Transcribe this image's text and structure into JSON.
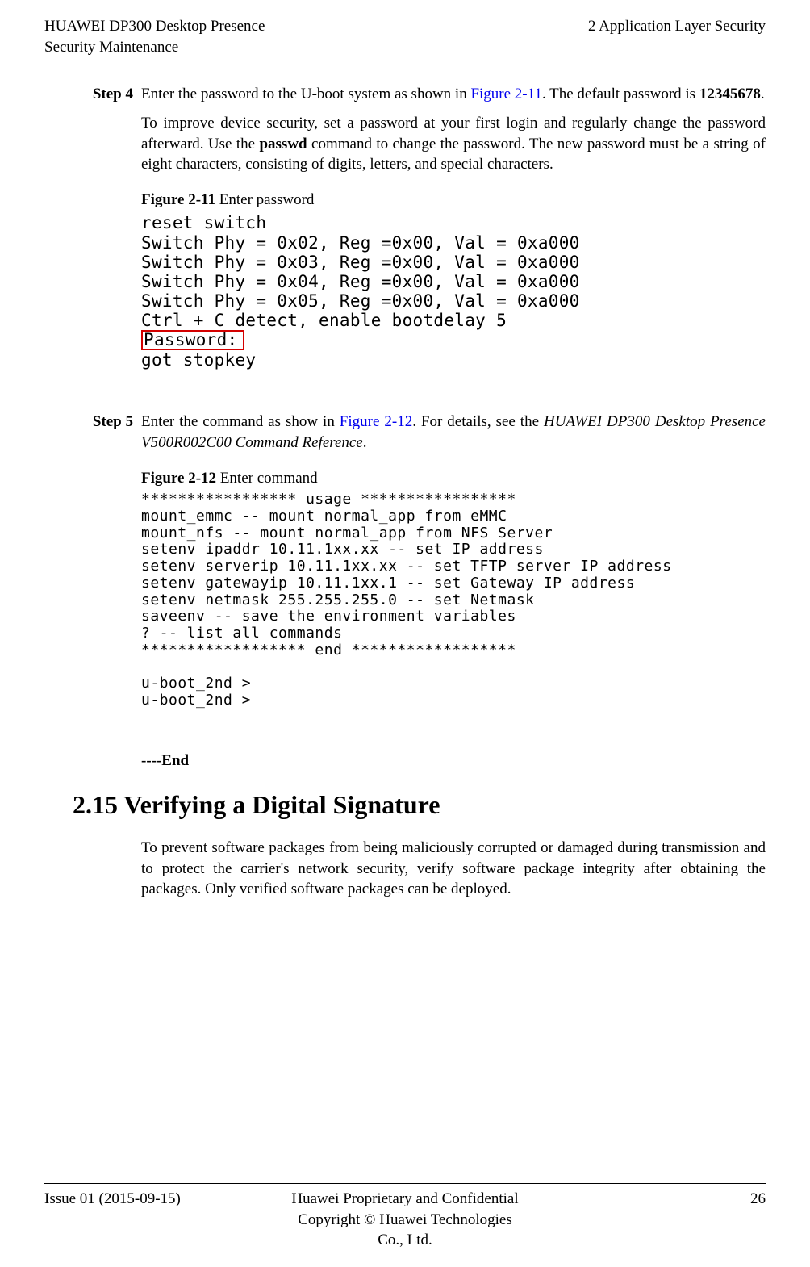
{
  "header": {
    "left_line1": "HUAWEI DP300 Desktop Presence",
    "left_line2": "Security Maintenance",
    "right_line1": "",
    "right_line2": "2 Application Layer Security"
  },
  "step4": {
    "label": "Step 4",
    "p1_a": "Enter the password to the U-boot system as shown in ",
    "p1_link": "Figure 2-11",
    "p1_b": ". The default password is ",
    "p1_bold": "12345678",
    "p1_c": ".",
    "p2_a": "To improve device security, set a password at your first login and regularly change the password afterward. Use the ",
    "p2_bold": "passwd",
    "p2_b": " command to change the password. The new password must be a string of eight characters, consisting of digits, letters, and special characters.",
    "fig_caption_bold": "Figure 2-11",
    "fig_caption_rest": " Enter password",
    "console_l1": "reset switch",
    "console_l2": "Switch Phy = 0x02, Reg =0x00, Val = 0xa000",
    "console_l3": "Switch Phy = 0x03, Reg =0x00, Val = 0xa000",
    "console_l4": "Switch Phy = 0x04, Reg =0x00, Val = 0xa000",
    "console_l5": "Switch Phy = 0x05, Reg =0x00, Val = 0xa000",
    "console_l6": "Ctrl + C detect, enable bootdelay 5",
    "console_pw": "Password:",
    "console_l8": "got stopkey"
  },
  "step5": {
    "label": "Step 5",
    "p1_a": "Enter the command as show in ",
    "p1_link": "Figure 2-12",
    "p1_b": ". For details, see the ",
    "p1_ital": "HUAWEI DP300 Desktop Presence V500R002C00 Command Reference",
    "p1_c": ".",
    "fig_caption_bold": "Figure 2-12",
    "fig_caption_rest": " Enter command",
    "console_l1": "***************** usage *****************",
    "console_l2": "mount_emmc -- mount normal_app from eMMC",
    "console_l3": "mount_nfs -- mount normal_app from NFS Server",
    "console_l4": "setenv ipaddr 10.11.1xx.xx -- set IP address",
    "console_l5": "setenv serverip 10.11.1xx.xx -- set TFTP server IP address",
    "console_l6": "setenv gatewayip 10.11.1xx.1 -- set Gateway IP address",
    "console_l7": "setenv netmask 255.255.255.0 -- set Netmask",
    "console_l8": "saveenv -- save the environment variables",
    "console_l9": "? -- list all commands",
    "console_l10": "****************** end ******************",
    "console_l11": "",
    "console_l12": "u-boot_2nd >",
    "console_l13": "u-boot_2nd >"
  },
  "end_marker": "----End",
  "section": {
    "title": "2.15 Verifying a Digital Signature",
    "body": "To prevent software packages from being maliciously corrupted or damaged during transmission and to protect the carrier's network security, verify software package integrity after obtaining the packages. Only verified software packages can be deployed."
  },
  "footer": {
    "left": "Issue 01 (2015-09-15)",
    "center_l1": "Huawei Proprietary and Confidential",
    "center_l2": "Copyright © Huawei Technologies Co., Ltd.",
    "right": "26"
  }
}
